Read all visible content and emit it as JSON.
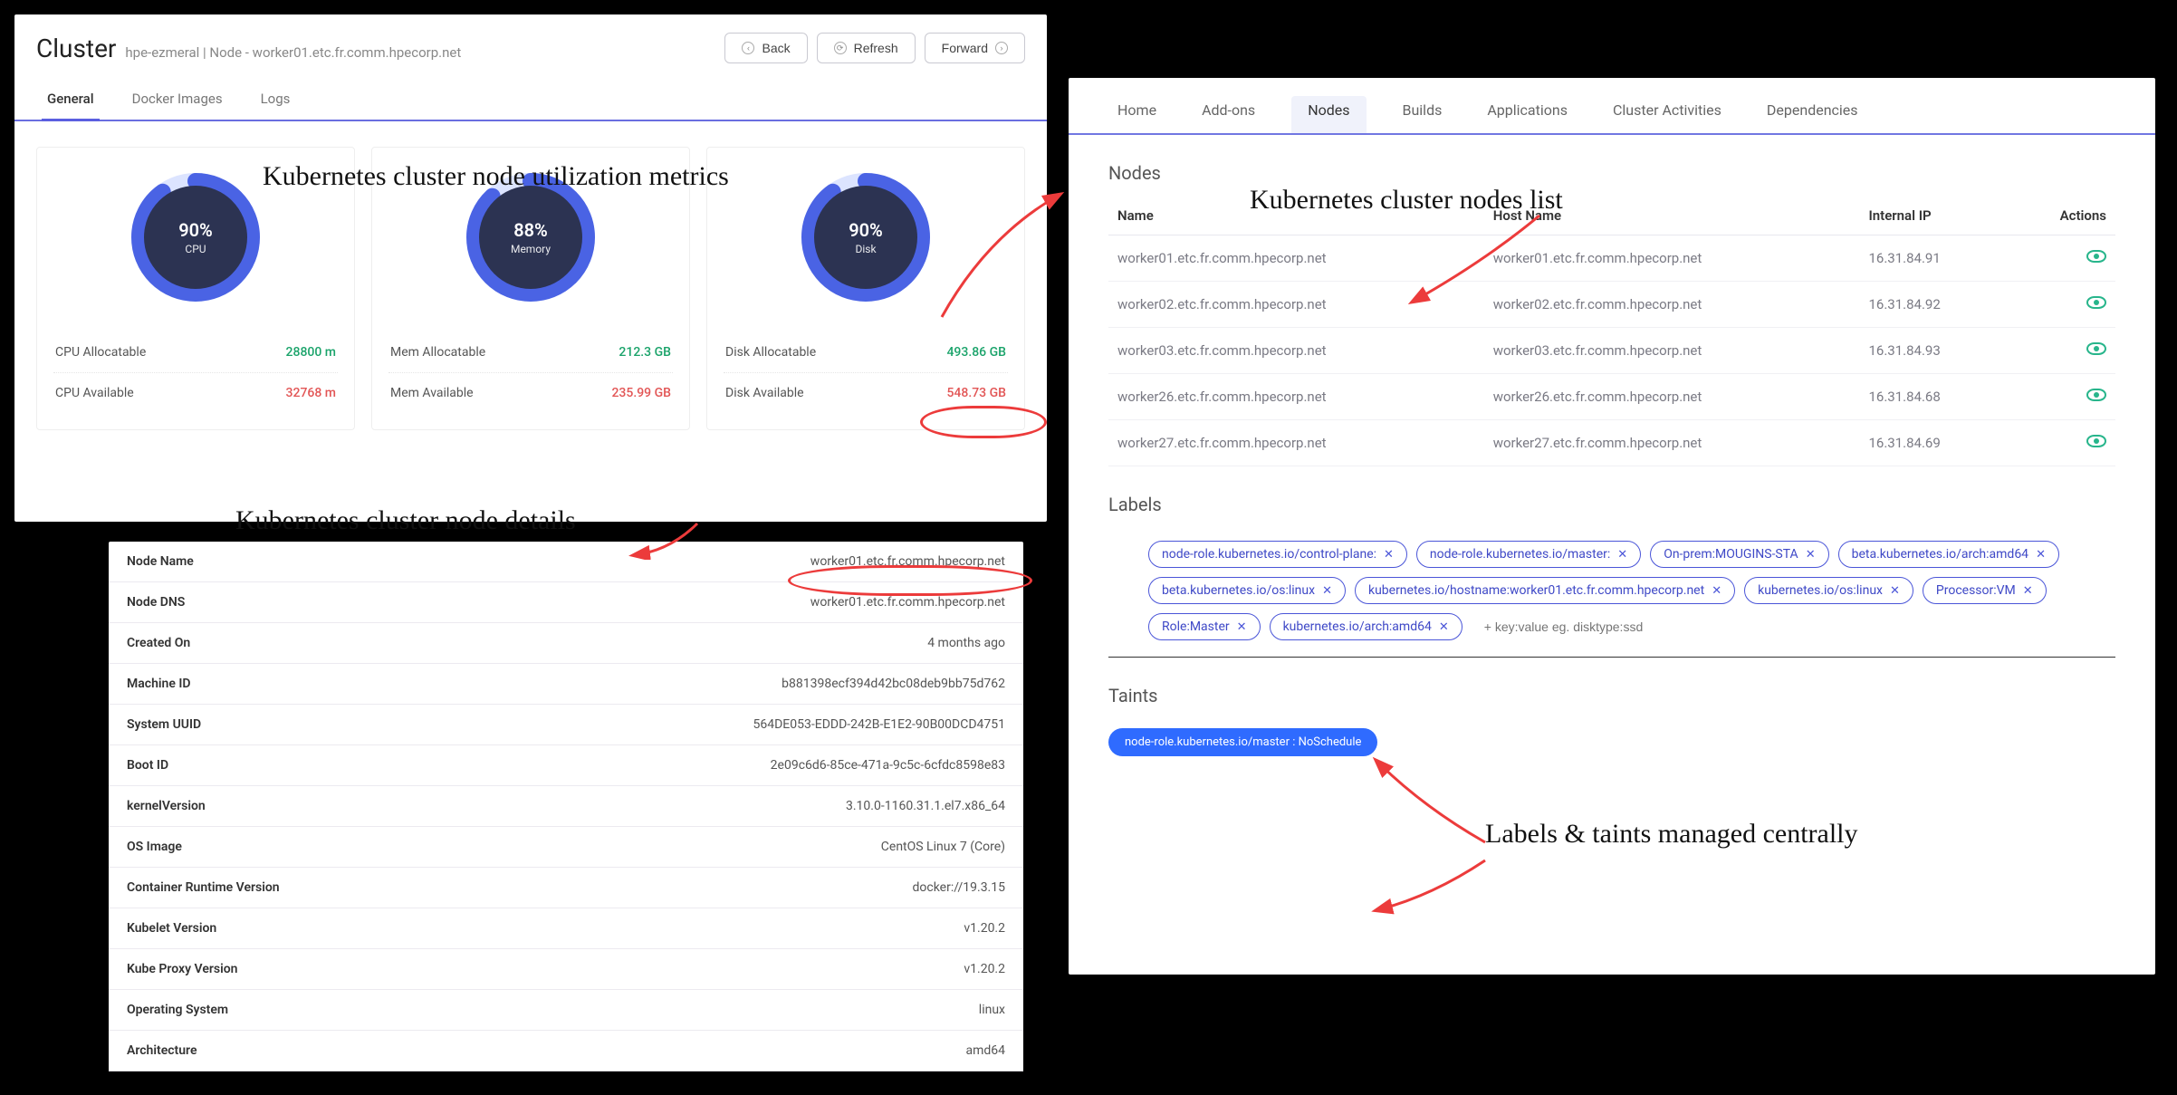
{
  "cluster": {
    "title": "Cluster",
    "crumb": "hpe-ezmeral  |  Node - worker01.etc.fr.comm.hpecorp.net",
    "buttons": {
      "back": "Back",
      "refresh": "Refresh",
      "forward": "Forward"
    },
    "tabs": [
      "General",
      "Docker Images",
      "Logs"
    ],
    "activeTab": 0
  },
  "metrics": [
    {
      "pct": "90%",
      "pctNum": 90,
      "label": "CPU",
      "allocLabel": "CPU Allocatable",
      "allocVal": "28800 m",
      "availLabel": "CPU Available",
      "availVal": "32768 m"
    },
    {
      "pct": "88%",
      "pctNum": 88,
      "label": "Memory",
      "allocLabel": "Mem Allocatable",
      "allocVal": "212.3 GB",
      "availLabel": "Mem Available",
      "availVal": "235.99 GB"
    },
    {
      "pct": "90%",
      "pctNum": 90,
      "label": "Disk",
      "allocLabel": "Disk Allocatable",
      "allocVal": "493.86 GB",
      "availLabel": "Disk Available",
      "availVal": "548.73 GB"
    }
  ],
  "details": [
    {
      "k": "Node Name",
      "v": "worker01.etc.fr.comm.hpecorp.net"
    },
    {
      "k": "Node DNS",
      "v": "worker01.etc.fr.comm.hpecorp.net"
    },
    {
      "k": "Created On",
      "v": "4 months ago"
    },
    {
      "k": "Machine ID",
      "v": "b881398ecf394d42bc08deb9bb75d762"
    },
    {
      "k": "System UUID",
      "v": "564DE053-EDDD-242B-E1E2-90B00DCD4751"
    },
    {
      "k": "Boot ID",
      "v": "2e09c6d6-85ce-471a-9c5c-6cfdc8598e83"
    },
    {
      "k": "kernelVersion",
      "v": "3.10.0-1160.31.1.el7.x86_64"
    },
    {
      "k": "OS Image",
      "v": "CentOS Linux 7 (Core)"
    },
    {
      "k": "Container Runtime Version",
      "v": "docker://19.3.15"
    },
    {
      "k": "Kubelet Version",
      "v": "v1.20.2"
    },
    {
      "k": "Kube Proxy Version",
      "v": "v1.20.2"
    },
    {
      "k": "Operating System",
      "v": "linux",
      "green": true
    },
    {
      "k": "Architecture",
      "v": "amd64"
    }
  ],
  "right": {
    "tabs": [
      "Home",
      "Add-ons",
      "Nodes",
      "Builds",
      "Applications",
      "Cluster Activities",
      "Dependencies"
    ],
    "activeTab": 2,
    "nodesTitle": "Nodes",
    "labelsTitle": "Labels",
    "taintsTitle": "Taints",
    "cols": {
      "name": "Name",
      "host": "Host Name",
      "ip": "Internal IP",
      "actions": "Actions"
    },
    "nodes": [
      {
        "name": "worker01.etc.fr.comm.hpecorp.net",
        "host": "worker01.etc.fr.comm.hpecorp.net",
        "ip": "16.31.84.91"
      },
      {
        "name": "worker02.etc.fr.comm.hpecorp.net",
        "host": "worker02.etc.fr.comm.hpecorp.net",
        "ip": "16.31.84.92"
      },
      {
        "name": "worker03.etc.fr.comm.hpecorp.net",
        "host": "worker03.etc.fr.comm.hpecorp.net",
        "ip": "16.31.84.93"
      },
      {
        "name": "worker26.etc.fr.comm.hpecorp.net",
        "host": "worker26.etc.fr.comm.hpecorp.net",
        "ip": "16.31.84.68"
      },
      {
        "name": "worker27.etc.fr.comm.hpecorp.net",
        "host": "worker27.etc.fr.comm.hpecorp.net",
        "ip": "16.31.84.69"
      }
    ],
    "labels": [
      "node-role.kubernetes.io/control-plane:",
      "node-role.kubernetes.io/master:",
      "On-prem:MOUGINS-STA",
      "beta.kubernetes.io/arch:amd64",
      "beta.kubernetes.io/os:linux",
      "kubernetes.io/hostname:worker01.etc.fr.comm.hpecorp.net",
      "kubernetes.io/os:linux",
      "Processor:VM",
      "Role:Master",
      "kubernetes.io/arch:amd64"
    ],
    "labelPlaceholder": "+ key:value eg. disktype:ssd",
    "taints": [
      "node-role.kubernetes.io/master : NoSchedule"
    ]
  },
  "annotations": {
    "metrics": "Kubernetes cluster node utilization metrics",
    "details": "Kubernetes cluster node details",
    "nodes": "Kubernetes cluster nodes list",
    "labels": "Labels & taints managed centrally"
  },
  "chart_data": [
    {
      "type": "pie",
      "title": "CPU",
      "values": [
        90,
        10
      ],
      "categories": [
        "used",
        "free"
      ],
      "display_pct": 90
    },
    {
      "type": "pie",
      "title": "Memory",
      "values": [
        88,
        12
      ],
      "categories": [
        "used",
        "free"
      ],
      "display_pct": 88
    },
    {
      "type": "pie",
      "title": "Disk",
      "values": [
        90,
        10
      ],
      "categories": [
        "used",
        "free"
      ],
      "display_pct": 90
    }
  ]
}
